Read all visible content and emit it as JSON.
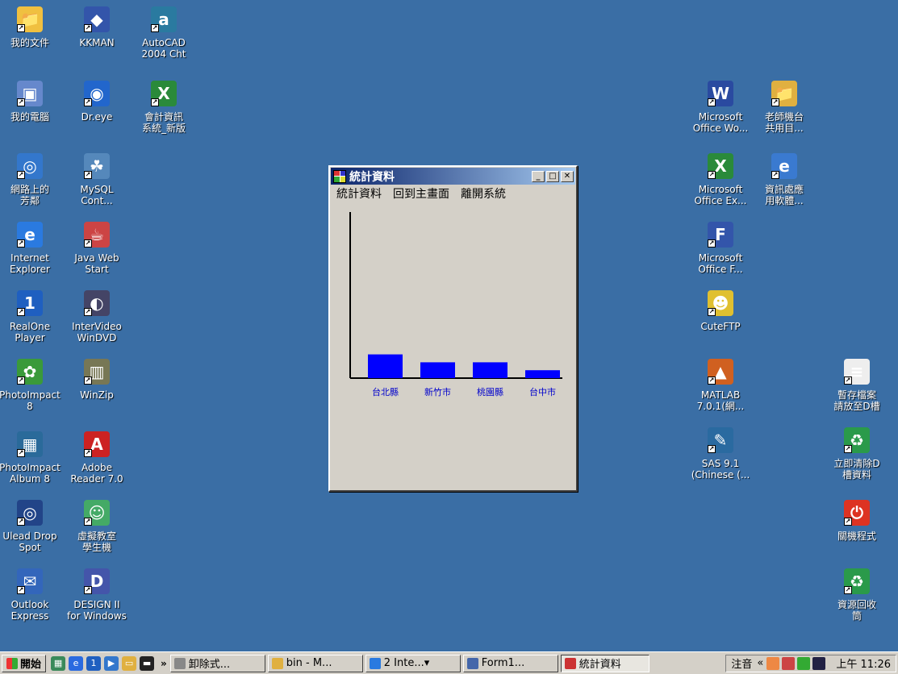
{
  "desktop": {
    "icons_left": [
      {
        "label": "我的文件",
        "icon": "folder-documents-icon",
        "color": "#f0c040",
        "glyph": "📁"
      },
      {
        "label": "KKMAN",
        "icon": "kkman-browser-icon",
        "color": "#3355aa",
        "glyph": "◆"
      },
      {
        "label": "AutoCAD\n2004 Cht",
        "icon": "autocad-icon",
        "color": "#2a7aa0",
        "glyph": "a"
      },
      {
        "label": "我的電腦",
        "icon": "my-computer-icon",
        "color": "#6688cc",
        "glyph": "▣"
      },
      {
        "label": "Dr.eye",
        "icon": "dreye-icon",
        "color": "#2266cc",
        "glyph": "◉"
      },
      {
        "label": "會計資訊\n系統_新版",
        "icon": "excel-file-icon",
        "color": "#2a8a3a",
        "glyph": "X"
      },
      {
        "label": "網路上的\n芳鄰",
        "icon": "network-places-icon",
        "color": "#3377cc",
        "glyph": "◎"
      },
      {
        "label": "MySQL\nCont...",
        "icon": "mysql-icon",
        "color": "#5588bb",
        "glyph": "☘"
      },
      {
        "label": "Internet\nExplorer",
        "icon": "internet-explorer-icon",
        "color": "#2a7ae0",
        "glyph": "e"
      },
      {
        "label": "Java Web\nStart",
        "icon": "java-web-start-icon",
        "color": "#cc4444",
        "glyph": "☕"
      },
      {
        "label": "RealOne\nPlayer",
        "icon": "realone-player-icon",
        "color": "#1f5fc0",
        "glyph": "1"
      },
      {
        "label": "InterVideo\nWinDVD",
        "icon": "windvd-icon",
        "color": "#444466",
        "glyph": "◐"
      },
      {
        "label": "PhotoImpact\n8",
        "icon": "photoimpact-icon",
        "color": "#3a9a3a",
        "glyph": "✿"
      },
      {
        "label": "WinZip",
        "icon": "winzip-icon",
        "color": "#777755",
        "glyph": "▥"
      },
      {
        "label": "PhotoImpact\nAlbum 8",
        "icon": "photoimpact-album-icon",
        "color": "#2a6a9a",
        "glyph": "▦"
      },
      {
        "label": "Adobe\nReader 7.0",
        "icon": "adobe-reader-icon",
        "color": "#cc2222",
        "glyph": "A"
      },
      {
        "label": "Ulead Drop\nSpot",
        "icon": "ulead-dropspot-icon",
        "color": "#224488",
        "glyph": "◎"
      },
      {
        "label": "虛擬教室\n學生機",
        "icon": "virtual-classroom-icon",
        "color": "#44aa66",
        "glyph": "☺"
      },
      {
        "label": "Outlook\nExpress",
        "icon": "outlook-express-icon",
        "color": "#3366bb",
        "glyph": "✉"
      },
      {
        "label": "DESIGN II\nfor Windows",
        "icon": "design2-icon",
        "color": "#4455aa",
        "glyph": "D"
      }
    ],
    "icons_right": [
      {
        "label": "Microsoft\nOffice Wo...",
        "icon": "word-icon",
        "color": "#2a4aa0",
        "glyph": "W"
      },
      {
        "label": "老師機台\n共用目...",
        "icon": "shared-folder-icon",
        "color": "#e0b040",
        "glyph": "📁"
      },
      {
        "label": "Microsoft\nOffice Ex...",
        "icon": "excel-icon",
        "color": "#2a8a3a",
        "glyph": "X"
      },
      {
        "label": "資訊處應\n用軟體...",
        "icon": "shortcut-file-icon",
        "color": "#3a7ad0",
        "glyph": "e"
      },
      {
        "label": "Microsoft\nOffice F...",
        "icon": "frontpage-icon",
        "color": "#3355aa",
        "glyph": "F"
      },
      {
        "label": "CuteFTP",
        "icon": "cuteftp-icon",
        "color": "#e0c030",
        "glyph": "☻"
      },
      {
        "label": "MATLAB\n7.0.1(網...",
        "icon": "matlab-icon",
        "color": "#d06020",
        "glyph": "▲"
      },
      {
        "label": "SAS 9.1\n(Chinese (...",
        "icon": "sas-icon",
        "color": "#2a6aa0",
        "glyph": "✎"
      },
      {
        "label": "暫存檔案\n請放至D槽",
        "icon": "text-document-icon",
        "color": "#eeeeee",
        "glyph": "≡"
      },
      {
        "label": "立即清除D\n槽資料",
        "icon": "recycle-clear-icon",
        "color": "#2a9a4a",
        "glyph": "♻"
      },
      {
        "label": "關機程式",
        "icon": "shutdown-icon",
        "color": "#dd3322",
        "glyph": "⏻"
      },
      {
        "label": "資源回收\n筒",
        "icon": "recycle-bin-icon",
        "color": "#2a9a4a",
        "glyph": "♻"
      }
    ]
  },
  "window": {
    "title": "統計資料",
    "controls": {
      "minimize": "_",
      "maximize": "□",
      "close": "✕"
    },
    "menu": [
      "統計資料",
      "回到主畫面",
      "離開系統"
    ]
  },
  "chart_data": {
    "type": "bar",
    "categories": [
      "台北縣",
      "新竹市",
      "桃園縣",
      "台中市"
    ],
    "values": [
      30,
      20,
      20,
      10
    ],
    "ylim": [
      0,
      210
    ],
    "bar_color": "#0000ff",
    "title": "",
    "xlabel": "",
    "ylabel": ""
  },
  "taskbar": {
    "start_label": "開始",
    "overflow": "»",
    "buttons": [
      {
        "label": "卸除式...",
        "icon": "removable-drive-icon",
        "color": "#888888"
      },
      {
        "label": "bin - M...",
        "icon": "folder-icon",
        "color": "#e0b040"
      },
      {
        "label": "2 Inte...▾",
        "icon": "internet-explorer-icon",
        "color": "#2a7ae0"
      },
      {
        "label": "Form1...",
        "icon": "form-icon",
        "color": "#4466aa"
      },
      {
        "label": "統計資料",
        "icon": "app-window-icon",
        "color": "#cc3333",
        "active": true
      }
    ],
    "tray_lang": "注音",
    "tray_expand": "«",
    "clock": "上午 11:26"
  }
}
